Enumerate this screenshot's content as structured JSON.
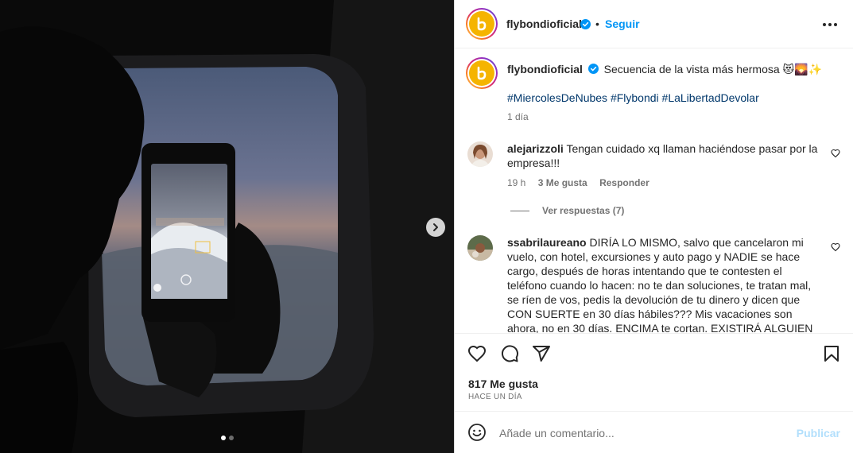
{
  "post": {
    "username": "flybondioficial",
    "follow_label": "Seguir",
    "separator": "•",
    "more_icon": "more-options-icon"
  },
  "caption": {
    "username": "flybondioficial",
    "text": "Secuencia de la vista más hermosa 😻🌄✨",
    "hashtags": "#MiercolesDeNubes #Flybondi #LaLibertadDevolar",
    "time": "1 día"
  },
  "comments": [
    {
      "username": "alejarizzoli",
      "text": "Tengan cuidado xq llaman haciéndose pasar por la empresa!!!",
      "time": "19 h",
      "likes": "3 Me gusta",
      "reply_label": "Responder",
      "view_replies": "Ver respuestas (7)"
    },
    {
      "username": "ssabrilaureano",
      "text": "DIRÍA LO MISMO, salvo que cancelaron mi vuelo, con hotel, excursiones y auto pago y NADIE se hace cargo, después de horas intentando que te contesten el teléfono cuando lo hacen: no te dan soluciones, te tratan mal, se ríen de vos, pedis la devolución de tu dinero y dicen que CON SUERTE en 30 días hábiles??? Mis vacaciones son ahora, no en 30 días. ENCIMA te cortan. EXISTIRÁ ALGUIEN EN ESTA"
    }
  ],
  "stats": {
    "likes": "817 Me gusta",
    "ago": "HACE UN DÍA"
  },
  "comment_box": {
    "placeholder": "Añade un comentario...",
    "publish_label": "Publicar"
  },
  "carousel": {
    "total": 2,
    "current": 1
  },
  "colors": {
    "accent": "#0095f6",
    "publish_disabled": "#b2dffc",
    "brand_yellow": "#f5b400"
  }
}
